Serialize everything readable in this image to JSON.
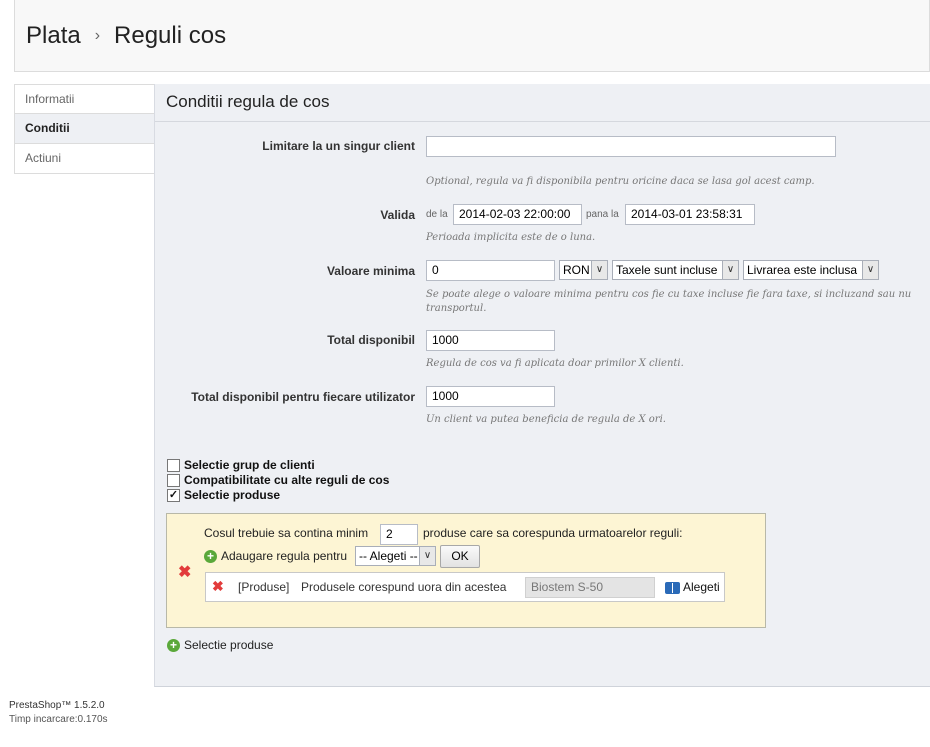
{
  "breadcrumb": {
    "parent": "Plata",
    "separator": "›",
    "current": "Reguli cos"
  },
  "tabs": [
    {
      "label": "Informatii",
      "active": false
    },
    {
      "label": "Conditii",
      "active": true
    },
    {
      "label": "Actiuni",
      "active": false
    }
  ],
  "panel": {
    "title": "Conditii regula de cos",
    "customer_limit": {
      "label": "Limitare la un singur client",
      "value": "",
      "hint": "Optional, regula va fi disponibila pentru oricine daca se lasa gol acest camp."
    },
    "valid": {
      "label": "Valida",
      "from_label": "de la",
      "from_value": "2014-02-03 22:00:00",
      "to_label": "pana la",
      "to_value": "2014-03-01 23:58:31",
      "hint": "Perioada implicita este de o luna."
    },
    "min_value": {
      "label": "Valoare minima",
      "value": "0",
      "currency": "RON",
      "tax": "Taxele sunt incluse",
      "shipping": "Livrarea este inclusa",
      "hint_line1": "Se poate alege o valoare minima pentru cos fie cu taxe incluse fie fara taxe, si incluzand sau nu",
      "hint_line2": "transportul."
    },
    "total_available": {
      "label": "Total disponibil",
      "value": "1000",
      "hint": "Regula de cos va fi aplicata doar primilor X clienti."
    },
    "total_per_user": {
      "label": "Total disponibil pentru fiecare utilizator",
      "value": "1000",
      "hint": "Un client va putea beneficia de regula de X ori."
    },
    "checkboxes": [
      {
        "label": "Selectie grup de clienti",
        "checked": false
      },
      {
        "label": "Compatibilitate cu alte reguli de cos",
        "checked": false
      },
      {
        "label": "Selectie produse",
        "checked": true
      }
    ],
    "rule_group": {
      "text_before": "Cosul trebuie sa contina minim",
      "quantity": "2",
      "text_after": "produse care sa corespunda urmatoarelor reguli:",
      "add_rule_label": "Adaugare regula pentru",
      "add_rule_select": "-- Alegeti --",
      "ok_label": "OK",
      "rule": {
        "type": "[Produse]",
        "text": "Produsele corespund uora din acestea",
        "value": "Biostem S-50",
        "choose_label": "Alegeti"
      }
    },
    "add_product_selection": "Selectie produse"
  },
  "footer": {
    "version": "PrestaShop™ 1.5.2.0",
    "load_time": "Timp incarcare:0.170s"
  }
}
